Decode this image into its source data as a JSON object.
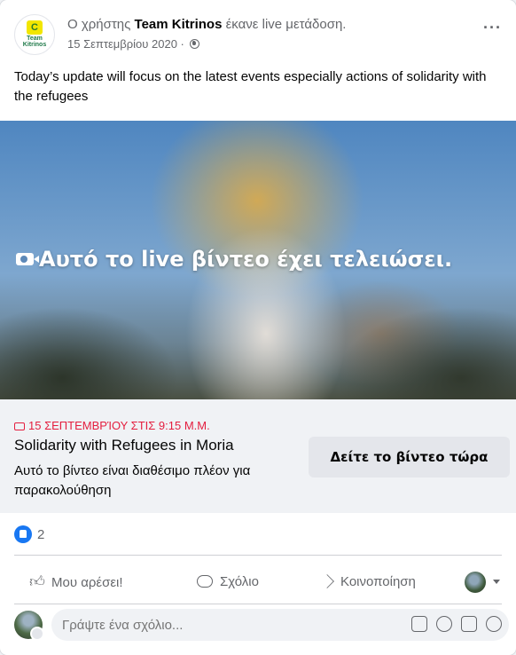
{
  "post": {
    "user_prefix": "Ο χρήστης",
    "user_name": "Team Kitrinos",
    "user_suffix": "έκανε live μετάδοση.",
    "date": "15 Σεπτεμβρίου 2020 ·",
    "more_label": "···",
    "text": "Today’s update will focus on the latest events especially actions of solidarity with the refugees",
    "avatar_letter": "C",
    "avatar_text": "Team Kitrinos"
  },
  "video": {
    "ended_text": "Αυτό το live βίντεο έχει τελειώσει."
  },
  "live_info": {
    "date": "15 ΣΕΠΤΕΜΒΡΊΟΥ ΣΤΙΣ 9:15 Μ.Μ.",
    "title": "Solidarity with Refugees in Moria",
    "subtitle": "Αυτό το βίντεο είναι διαθέσιμο πλέον για παρακολούθηση",
    "watch_button": "Δείτε το βίντεο τώρα"
  },
  "reactions": {
    "count": "2"
  },
  "actions": {
    "like": "Μου αρέσει!",
    "comment": "Σχόλιο",
    "share": "Κοινοποίηση"
  },
  "comment_box": {
    "placeholder": "Γράψτε ένα σχόλιο..."
  },
  "colors": {
    "accent_blue": "#1877f2",
    "live_red": "#e41e3f",
    "muted_text": "#65676b"
  },
  "icons": [
    "globe-icon",
    "more-icon",
    "camera-icon",
    "live-video-icon",
    "like-reaction-icon",
    "thumbs-up-icon",
    "comment-icon",
    "share-icon",
    "sticker-icon",
    "emoji-icon",
    "gif-icon",
    "avatar-sticker-icon"
  ]
}
